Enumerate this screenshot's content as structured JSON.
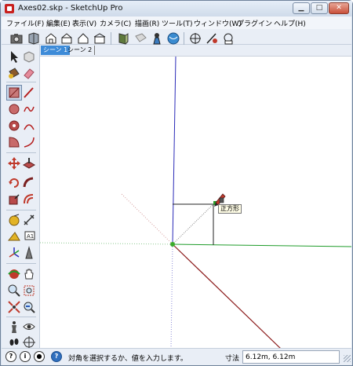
{
  "window": {
    "title": "Axes02.skp - SketchUp Pro",
    "controls": [
      "minimize",
      "maximize",
      "close"
    ]
  },
  "menu": {
    "items": [
      "ファイル(F)",
      "編集(E)",
      "表示(V)",
      "カメラ(C)",
      "描画(R)",
      "ツール(T)",
      "ウィンドウ(W)",
      "プラグイン",
      "ヘルプ(H)"
    ]
  },
  "toolbar_icons": [
    "camera-icon",
    "components-icon",
    "iso-view-icon",
    "top-view-icon",
    "front-view-icon",
    "right-view-icon",
    "back-edges-icon",
    "wireframe-icon",
    "hidden-line-icon",
    "shaded-icon",
    "axes-tool-icon",
    "tape-measure-icon",
    "dimension-icon"
  ],
  "scene_tabs": {
    "tabs": [
      "シーン 1",
      "シーン 2"
    ],
    "active": 0
  },
  "viewport": {
    "tooltip": "正方形",
    "colors": {
      "red_axis": "#8b1a1a",
      "green_axis": "#1f9c2a",
      "blue_axis": "#2a2ab8",
      "origin": "#3aaa2a"
    }
  },
  "status": {
    "message": "対角を選択するか、値を入力します。",
    "measure_label": "寸法",
    "measure_value": "6.12m, 6.12m"
  }
}
